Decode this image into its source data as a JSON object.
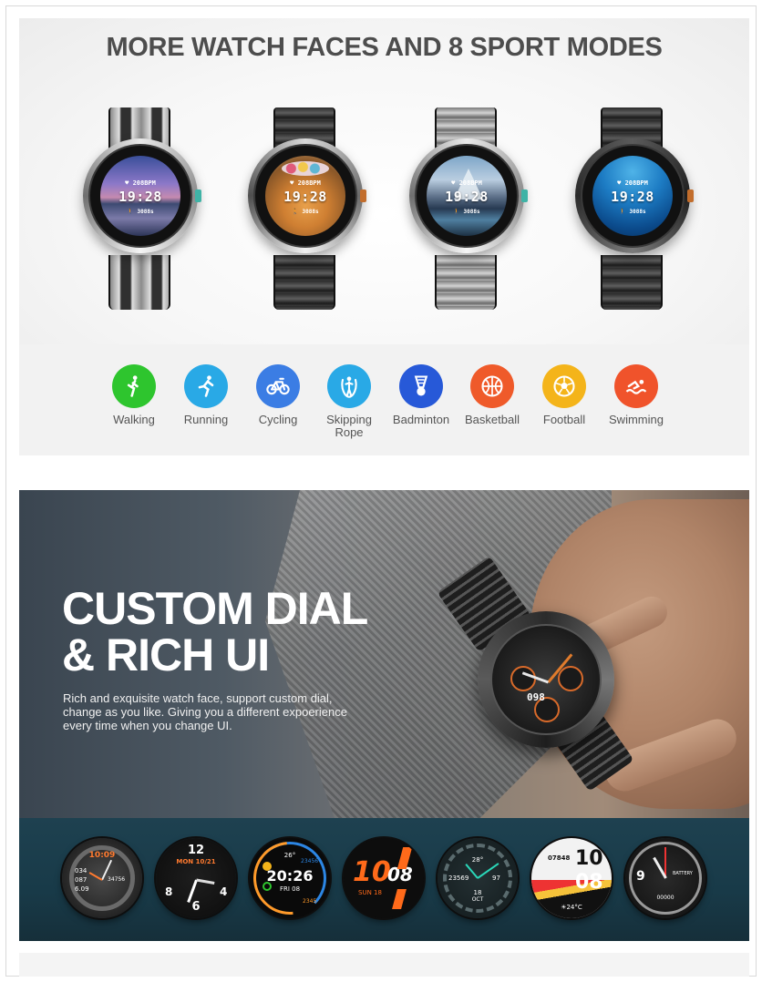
{
  "section1": {
    "headline": "MORE WATCH FACES AND 8 SPORT MODES",
    "watches": [
      {
        "heart_rate": "♥ 208BPM",
        "time": "19:28",
        "steps": "🚶 3088s"
      },
      {
        "heart_rate": "♥ 208BPM",
        "time": "19:28",
        "steps": "🚶 3088s"
      },
      {
        "heart_rate": "♥ 208BPM",
        "time": "19:28",
        "steps": "🚶 3088s"
      },
      {
        "heart_rate": "♥ 208BPM",
        "time": "19:28",
        "steps": "🚶 3088s"
      }
    ],
    "sport_modes": [
      {
        "label": "Walking",
        "icon": "walking-icon",
        "color": "#2ec52e"
      },
      {
        "label": "Running",
        "icon": "running-icon",
        "color": "#29a9e6"
      },
      {
        "label": "Cycling",
        "icon": "cycling-icon",
        "color": "#3b7de4"
      },
      {
        "label": "Skipping Rope",
        "icon": "skipping-rope-icon",
        "color": "#29a9e6"
      },
      {
        "label": "Badminton",
        "icon": "badminton-icon",
        "color": "#2759d8"
      },
      {
        "label": "Basketball",
        "icon": "basketball-icon",
        "color": "#ef5a2a"
      },
      {
        "label": "Football",
        "icon": "football-icon",
        "color": "#f4b41a"
      },
      {
        "label": "Swimming",
        "icon": "swimming-icon",
        "color": "#f0532b"
      }
    ]
  },
  "section2": {
    "title_line1": "CUSTOM DIAL",
    "title_line2": "& RICH UI",
    "description": "Rich and exquisite watch face, support custom dial, change as you like. Giving you a different expoerience every time when you change UI.",
    "watch_face_number": "098"
  },
  "dials": [
    {
      "time": "10:09",
      "values": [
        "034",
        "087",
        "6.09"
      ],
      "extra": "34756"
    },
    {
      "date": "MON 10/21",
      "numbers": [
        "12",
        "6",
        "8",
        "4"
      ]
    },
    {
      "top": "26°",
      "time": "20:26",
      "date": "FRI 08",
      "vals": [
        "23456",
        "2345"
      ]
    },
    {
      "hour": "10",
      "minute": "08",
      "date": "SUN 18"
    },
    {
      "left": "23569",
      "right": "97",
      "bottom_top": "18",
      "bottom": "OCT",
      "top": "28°"
    },
    {
      "steps": "07848",
      "hour": "10",
      "minute": "08",
      "temp": "☀24°C"
    },
    {
      "hour_label": "9",
      "label": "BATTERY",
      "sub": "00000"
    }
  ]
}
